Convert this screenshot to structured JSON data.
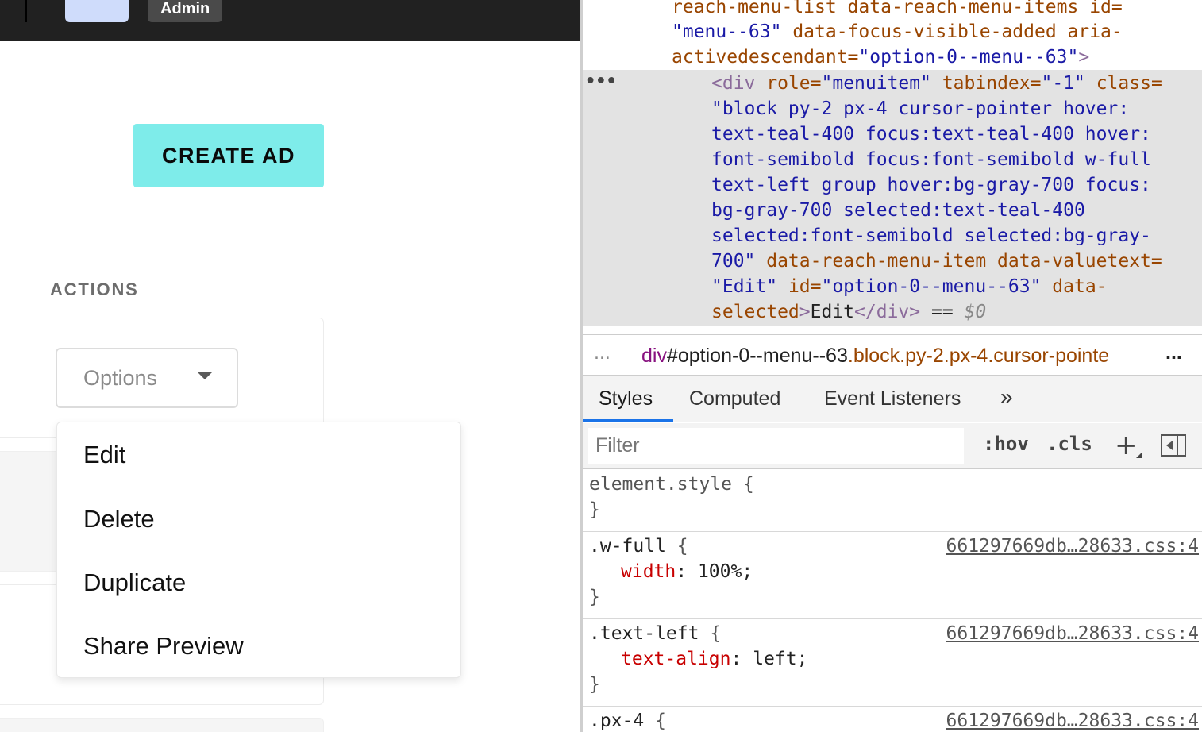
{
  "app": {
    "admin_badge": "Admin",
    "create_button": "CREATE AD",
    "section_label": "ACTIONS",
    "options_select": {
      "label": "Options"
    },
    "menu": {
      "items": [
        {
          "label": "Edit"
        },
        {
          "label": "Delete"
        },
        {
          "label": "Duplicate"
        },
        {
          "label": "Share Preview"
        }
      ]
    }
  },
  "devtools": {
    "dom_lines": {
      "l1_a": "reach-menu-list data-reach-menu-items id=",
      "l2_a": "\"menu--63\"",
      "l2_b": " data-focus-visible-added aria-",
      "l3_a": "activedescendant=",
      "l3_b": "\"option-0--menu--63\"",
      "l3_c": ">",
      "h1_tag": "<div ",
      "h1_a1": "role=",
      "h1_v1": "\"menuitem\"",
      "h1_a2": " tabindex=",
      "h1_v2": "\"-1\"",
      "h1_a3": " class=",
      "h2": "\"block py-2 px-4 cursor-pointer hover:",
      "h3": "text-teal-400 focus:text-teal-400 hover:",
      "h4": "font-semibold focus:font-semibold w-full",
      "h5": "text-left group hover:bg-gray-700 focus:",
      "h6": "bg-gray-700 selected:text-teal-400",
      "h7": "selected:font-semibold selected:bg-gray-",
      "h8_v": "700\"",
      "h8_a": " data-reach-menu-item data-valuetext=",
      "h9_v1": "\"Edit\"",
      "h9_a": " id=",
      "h9_v2": "\"option-0--menu--63\"",
      "h9_b": " data-",
      "h10_a": "selected",
      "h10_t1": ">",
      "h10_txt": "Edit",
      "h10_t2": "</div>",
      "h10_eq": " == ",
      "h10_dollar": "$0"
    },
    "breadcrumb": {
      "more": "...",
      "tag": "div",
      "id": "#option-0--menu--63",
      "classes": ".block.py-2.px-4.cursor-pointe",
      "more_right": "..."
    },
    "tabs": [
      {
        "label": "Styles"
      },
      {
        "label": "Computed"
      },
      {
        "label": "Event Listeners"
      }
    ],
    "tabs_more": "»",
    "filter": {
      "placeholder": "Filter",
      "hov": ":hov",
      "cls": ".cls"
    },
    "rules": {
      "element_style": "element.style",
      "r1_selector": ".w-full",
      "r1_source": "661297669db…28633.css:4",
      "r1_prop": "width",
      "r1_value": " 100%;",
      "r2_selector": ".text-left",
      "r2_source": "661297669db…28633.css:4",
      "r2_prop": "text-align",
      "r2_value": " left;",
      "r3_selector": ".px-4",
      "r3_source": "661297669db…28633.css:4"
    }
  }
}
